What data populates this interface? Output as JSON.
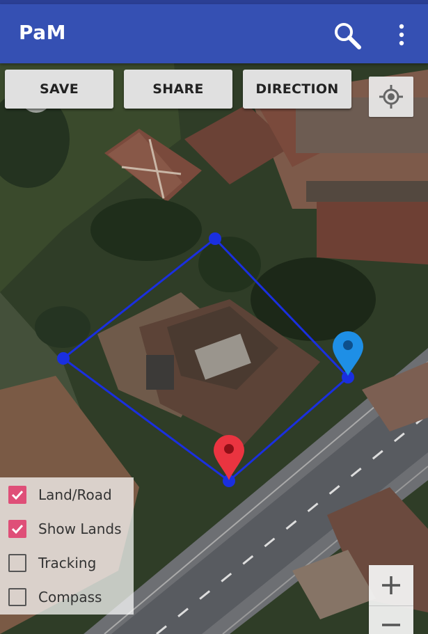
{
  "app": {
    "title": "PaM"
  },
  "toolbar": {
    "save_label": "SAVE",
    "share_label": "SHARE",
    "direction_label": "DIRECTION"
  },
  "layers": [
    {
      "label": "Land/Road",
      "checked": true
    },
    {
      "label": "Show Lands",
      "checked": true
    },
    {
      "label": "Tracking",
      "checked": false
    },
    {
      "label": "Compass",
      "checked": false
    }
  ],
  "map": {
    "polygon_color": "#1a2fe0",
    "marker_red": "#ea3440",
    "marker_blue": "#1e8fe6"
  },
  "icons": [
    "search-icon",
    "more-vert-icon",
    "my-location-icon",
    "zoom-in-icon",
    "zoom-out-icon"
  ]
}
